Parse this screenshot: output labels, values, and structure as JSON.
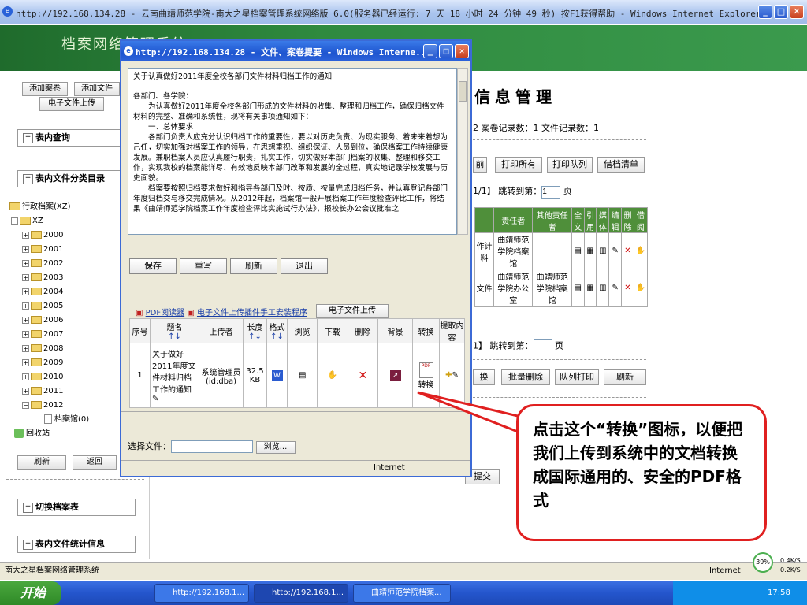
{
  "browser": {
    "title": "http://192.168.134.28 - 云南曲靖师范学院-南大之星档案管理系统网络版 6.0(服务器已经运行: 7 天 18 小时 24 分钟 49 秒) 按F1获得帮助 - Windows Internet Explorer",
    "status_text": "南大之星档案网络管理系统",
    "zone": "Internet",
    "zoom": "39%",
    "speed_up": "0.4K/S",
    "speed_down": "0.2K/S"
  },
  "banner": {
    "title": "档案网络管理系统"
  },
  "left": {
    "btn_add_case": "添加案卷",
    "btn_add_file": "添加文件",
    "btn_upload": "电子文件上传",
    "sec_query": "表内查询",
    "sec_catalog": "表内文件分类目录",
    "tree_root": "行政档案(XZ)",
    "tree_xz": "XZ",
    "years": [
      "2000",
      "2001",
      "2002",
      "2003",
      "2004",
      "2005",
      "2006",
      "2007",
      "2008",
      "2009",
      "2010",
      "2011",
      "2012"
    ],
    "tree_leaf": "档案馆(0)",
    "recycle": "回收站",
    "btn_refresh": "刷新",
    "btn_back": "返回",
    "sec_switch": "切换档案表",
    "sec_stats": "表内文件统计信息"
  },
  "main": {
    "title": "信息管理",
    "records": "2  案卷记录数：1  文件记录数：1",
    "btns1": [
      "前",
      "打印所有",
      "打印队列",
      "借档清单"
    ],
    "paging1": "1/1】  跳转到第：",
    "page_val": "1",
    "page_unit": "页",
    "headers": [
      "责任者",
      "其他责任者",
      "全文",
      "引用",
      "媒体",
      "编辑",
      "删除",
      "借阅"
    ],
    "row1": {
      "c1": "作计料",
      "c2": "曲靖师范学院档案馆"
    },
    "row2": {
      "c1": "文件",
      "c2": "曲靖师范学院办公室",
      "c3": "曲靖师范学院档案馆"
    },
    "paging2": "1】  跳转到第：",
    "btns2": [
      "换",
      "批量删除",
      "队列打印",
      "刷新"
    ],
    "submit": "提交"
  },
  "popup": {
    "title": "http://192.168.134.28 - 文件、案卷提要 - Windows Interne...",
    "doc_title": "关于认真做好2011年度全校各部门文件材料归档工作的通知",
    "doc_salute": "各部门、各学院：",
    "doc_p1": "为认真做好2011年度全校各部门形成的文件材料的收集、整理和归档工作，确保归档文件材料的完整、准确和系统性，现将有关事项通知如下：",
    "doc_h1": "一、总体要求",
    "doc_p2": "各部门负责人应充分认识归档工作的重要性，要以对历史负责、为现实服务、着未来着想为己任，切实加强对档案工作的领导，在思想重视、组织保证、人员到位，确保档案工作持续健康发展。兼职档案人员应认真履行职责，扎实工作，切实做好本部门档案的收集、整理和移交工作，实现我校的档案能详尽、有效地反映本部门改革和发展的全过程，真实地记录学校发展与历史面貌。",
    "doc_p3": "档案要按照归档要求做好和指导各部门及时、按质、按量完成归档任务，并认真登记各部门年度归档交与移交完成情况。从2012年起，档案馆一般开展档案工作年度检查评比工作，将结果《曲靖师范学院档案工作年度检查评比实施试行办法》，报校长办公会议批准之",
    "btn_save": "保存",
    "btn_reset": "重写",
    "btn_refresh": "刷新",
    "btn_exit": "退出",
    "link_pdf": "PDF阅读器",
    "link_plugin": "电子文件上传插件手工安装程序",
    "btn_upload": "电子文件上传",
    "col_headers": [
      "序号",
      "题名",
      "上传者",
      "长度",
      "格式",
      "浏览",
      "下载",
      "删除",
      "背景",
      "转换",
      "提取内容"
    ],
    "row": {
      "no": "1",
      "title": "关于做好2011年度文件材料归档工作的通知",
      "uploader": "系统管理员(id:dba)",
      "size": "32.5 KB",
      "convert": "转换"
    },
    "select_file": "选择文件：",
    "browse": "浏览...",
    "status_zone": "Internet"
  },
  "callout": {
    "text": "点击这个“转换”图标，以便把我们上传到系统中的文档转换成国际通用的、安全的PDF格式"
  },
  "taskbar": {
    "start": "开始",
    "tasks": [
      "http://192.168.1...",
      "http://192.168.1...",
      "曲靖师范学院档案..."
    ],
    "clock": "17:58"
  },
  "colors": {
    "banner": "#2f8a3f",
    "accent": "#1e55d0",
    "callout_border": "#e02020"
  }
}
